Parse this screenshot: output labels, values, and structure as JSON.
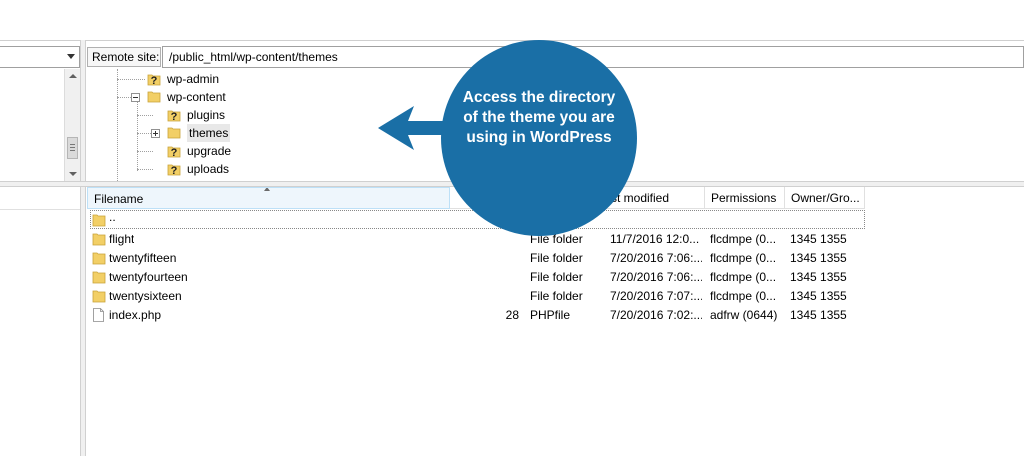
{
  "remote": {
    "label": "Remote site:",
    "path": "/public_html/wp-content/themes"
  },
  "tree": [
    {
      "label": "wp-admin",
      "icon": "unknown-folder-icon"
    },
    {
      "label": "wp-content",
      "icon": "folder-icon",
      "expanded": true
    },
    {
      "label": "plugins",
      "icon": "unknown-folder-icon"
    },
    {
      "label": "themes",
      "icon": "folder-icon",
      "selected": true
    },
    {
      "label": "upgrade",
      "icon": "unknown-folder-icon"
    },
    {
      "label": "uploads",
      "icon": "unknown-folder-icon"
    }
  ],
  "columns": {
    "filename": "Filename",
    "modified": "st modified",
    "permissions": "Permissions",
    "owner": "Owner/Gro..."
  },
  "files": [
    {
      "name": "..",
      "size": "",
      "type": "",
      "modified": "",
      "perms": "",
      "owner": "",
      "icon": "folder-icon"
    },
    {
      "name": "flight",
      "size": "",
      "type": "File folder",
      "modified": "11/7/2016 12:0...",
      "perms": "flcdmpe (0...",
      "owner": "1345 1355",
      "icon": "folder-icon"
    },
    {
      "name": "twentyfifteen",
      "size": "",
      "type": "File folder",
      "modified": "7/20/2016 7:06:...",
      "perms": "flcdmpe (0...",
      "owner": "1345 1355",
      "icon": "folder-icon"
    },
    {
      "name": "twentyfourteen",
      "size": "",
      "type": "File folder",
      "modified": "7/20/2016 7:06:...",
      "perms": "flcdmpe (0...",
      "owner": "1345 1355",
      "icon": "folder-icon"
    },
    {
      "name": "twentysixteen",
      "size": "",
      "type": "File folder",
      "modified": "7/20/2016 7:07:...",
      "perms": "flcdmpe (0...",
      "owner": "1345 1355",
      "icon": "folder-icon"
    },
    {
      "name": "index.php",
      "size": "28",
      "type": "PHPfile",
      "modified": "7/20/2016 7:02:...",
      "perms": "adfrw (0644)",
      "owner": "1345 1355",
      "icon": "file-icon"
    }
  ],
  "callout": {
    "text": "Access the directory of the theme you are using in WordPress",
    "color": "#1a6fa6"
  }
}
